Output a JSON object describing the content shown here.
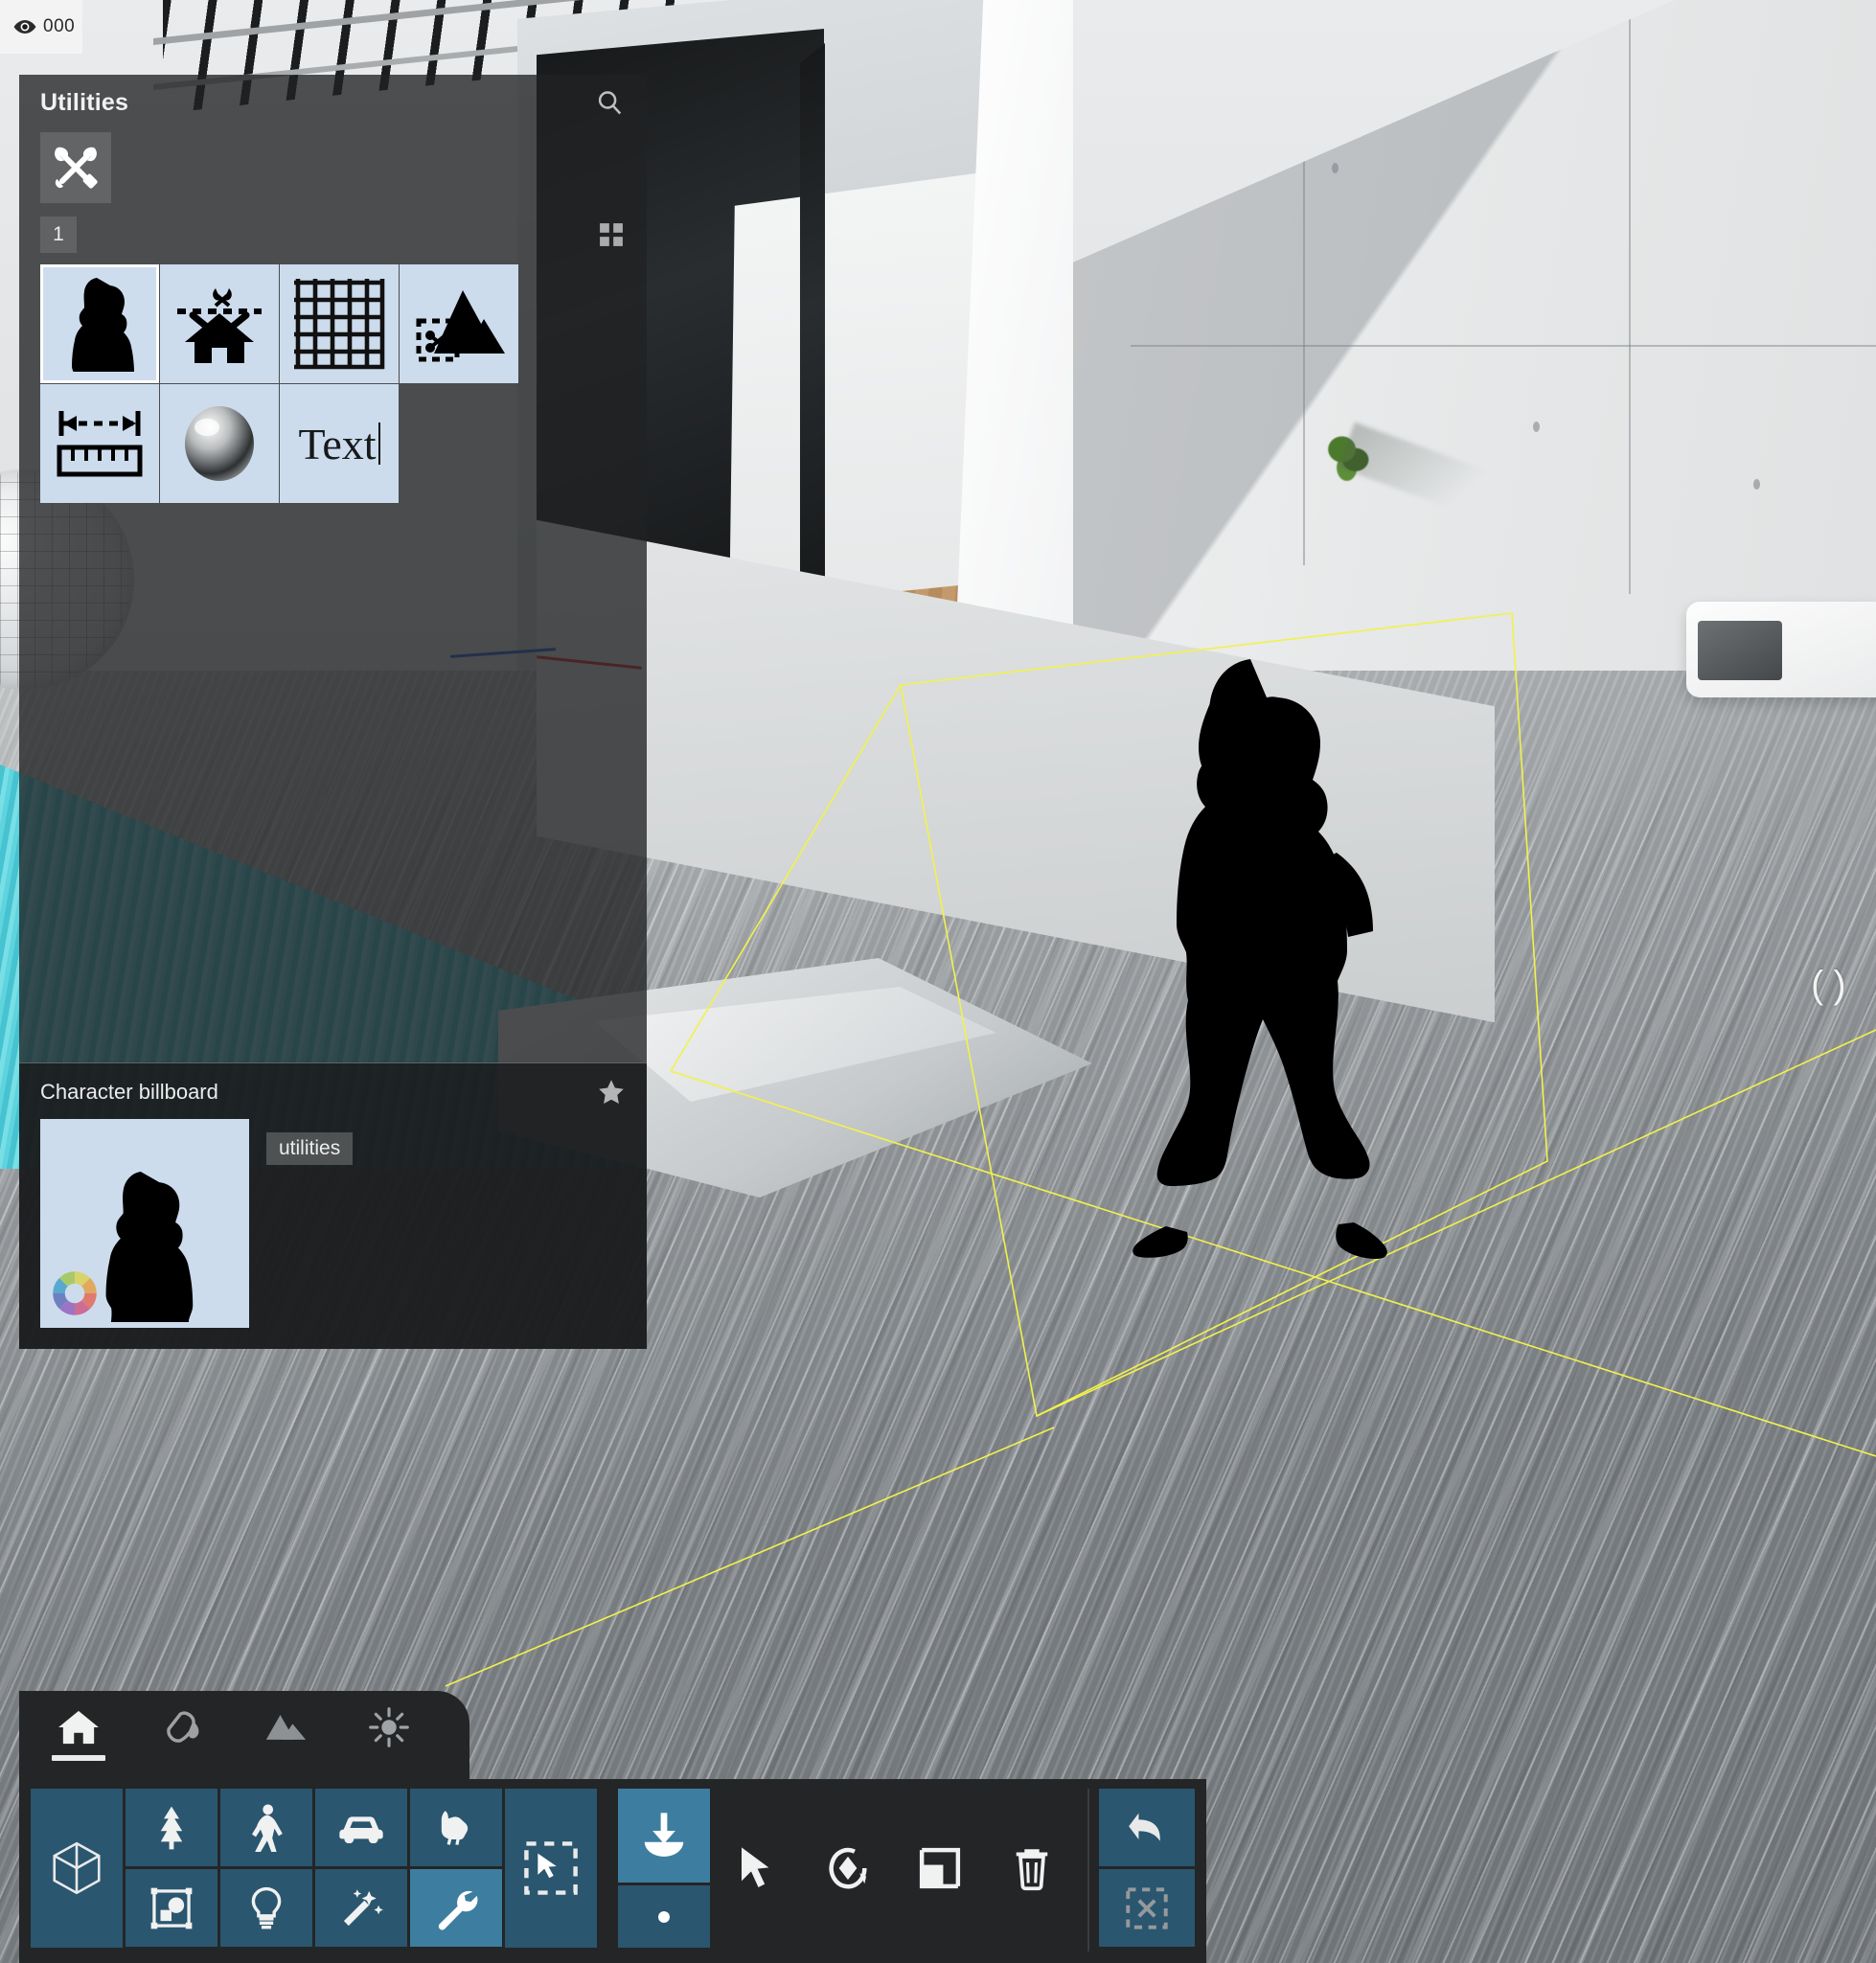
{
  "viewport": {
    "overlay_badge": {
      "icon": "eye-icon",
      "count": "000"
    },
    "selection": {
      "object": "Character billboard",
      "bbox_color": "#f2f24a"
    },
    "scene_description": "Modern architectural 3D scene with glass wall, white concrete walls, wood floor interior, swimming pool and concrete terrace"
  },
  "utilities_panel": {
    "title": "Utilities",
    "search_icon": "search-icon",
    "category": {
      "icon": "tools-icon",
      "label": "Utilities"
    },
    "page_number": "1",
    "view_toggle_icon": "grid-view-icon",
    "assets": [
      {
        "name": "Character billboard",
        "icon": "character-silhouette-icon",
        "selected": true
      },
      {
        "name": "Building cutout",
        "icon": "house-cutout-icon",
        "selected": false
      },
      {
        "name": "Grid",
        "icon": "grid-icon",
        "selected": false
      },
      {
        "name": "Terrain cutout",
        "icon": "mountain-cutout-icon",
        "selected": false
      },
      {
        "name": "Measurement",
        "icon": "ruler-measure-icon",
        "selected": false
      },
      {
        "name": "Reflection probe",
        "icon": "chrome-sphere-icon",
        "selected": false
      },
      {
        "name": "Text",
        "icon": "text-icon",
        "label": "Text",
        "selected": false
      }
    ]
  },
  "detail": {
    "title": "Character billboard",
    "favorite_icon": "star-icon",
    "thumbnail_icon": "character-silhouette-icon",
    "color_wheel_icon": "color-wheel-icon",
    "tag": "utilities"
  },
  "bottom_bar": {
    "tabs": [
      {
        "name": "home",
        "icon": "house-icon",
        "active": true
      },
      {
        "name": "materials",
        "icon": "paint-bucket-icon",
        "active": false
      },
      {
        "name": "terrain",
        "icon": "mountain-icon",
        "active": false
      },
      {
        "name": "lighting",
        "icon": "sun-icon",
        "active": false
      }
    ],
    "tools": {
      "primary": {
        "name": "building",
        "icon": "building-wireframe-icon"
      },
      "row1": [
        {
          "name": "vegetation",
          "icon": "tree-icon"
        },
        {
          "name": "people",
          "icon": "person-icon"
        },
        {
          "name": "vehicles",
          "icon": "car-icon"
        },
        {
          "name": "animals",
          "icon": "animal-icon"
        }
      ],
      "row2": [
        {
          "name": "objects",
          "icon": "object-group-icon"
        },
        {
          "name": "lights",
          "icon": "lightbulb-icon"
        },
        {
          "name": "effects",
          "icon": "magic-wand-icon"
        },
        {
          "name": "utilities",
          "icon": "wrench-icon",
          "active": true
        }
      ],
      "marquee": {
        "name": "select-region",
        "icon": "marquee-select-icon"
      },
      "snap": {
        "name": "drop-to-ground",
        "icon": "drop-down-icon",
        "active": true
      },
      "point": {
        "name": "point-snap",
        "icon": "dot-icon"
      },
      "actions": [
        {
          "name": "select",
          "icon": "arrow-cursor-icon"
        },
        {
          "name": "rotate",
          "icon": "rotate-icon"
        },
        {
          "name": "scale",
          "icon": "scale-icon"
        },
        {
          "name": "delete",
          "icon": "trash-icon"
        }
      ],
      "right": [
        {
          "name": "undo",
          "icon": "undo-arrow-icon"
        },
        {
          "name": "clear-selection",
          "icon": "clear-selection-icon"
        }
      ]
    }
  }
}
